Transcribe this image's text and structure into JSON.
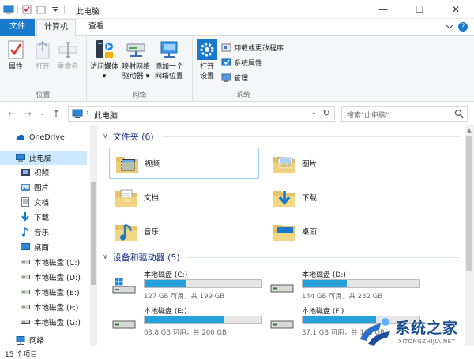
{
  "window": {
    "title": "此电脑",
    "controls": {
      "minimize": "—",
      "maximize": "☐",
      "close": "✕"
    }
  },
  "tabs": {
    "file": "文件",
    "computer": "计算机",
    "view": "查看",
    "help": "?"
  },
  "ribbon": {
    "location": {
      "label": "位置",
      "properties": "属性",
      "open": "打开",
      "rename": "重命名"
    },
    "network": {
      "label": "网络",
      "media": [
        "访问媒体",
        "▾"
      ],
      "map_drive": [
        "映射网络",
        "驱动器 ▾"
      ],
      "add_location": [
        "添加一个",
        "网络位置"
      ]
    },
    "system": {
      "label": "系统",
      "open_settings": [
        "打开",
        "设置"
      ],
      "uninstall": "卸载或更改程序",
      "system_props": "系统属性",
      "manage": "管理"
    }
  },
  "address": {
    "path": "此电脑",
    "search_placeholder": "搜索\"此电脑\"",
    "back": "←",
    "forward": "→",
    "recent": "⌄",
    "up": "↑",
    "refresh": "↻"
  },
  "nav": {
    "items": [
      {
        "label": "OneDrive",
        "icon": "cloud-icon"
      },
      {
        "label": "此电脑",
        "icon": "pc-icon"
      },
      {
        "label": "视频",
        "icon": "video-icon"
      },
      {
        "label": "图片",
        "icon": "picture-icon"
      },
      {
        "label": "文档",
        "icon": "document-icon"
      },
      {
        "label": "下载",
        "icon": "download-icon"
      },
      {
        "label": "音乐",
        "icon": "music-icon"
      },
      {
        "label": "桌面",
        "icon": "desktop-icon"
      },
      {
        "label": "本地磁盘 (C:)",
        "icon": "drive-icon"
      },
      {
        "label": "本地磁盘 (D:)",
        "icon": "drive-icon"
      },
      {
        "label": "本地磁盘 (E:)",
        "icon": "drive-icon"
      },
      {
        "label": "本地磁盘 (F:)",
        "icon": "drive-icon"
      },
      {
        "label": "本地磁盘 (G:)",
        "icon": "drive-icon"
      },
      {
        "label": "网络",
        "icon": "network-icon"
      }
    ]
  },
  "folders_section": {
    "title": "文件夹 (6)"
  },
  "folders": [
    {
      "name": "视频",
      "icon": "video-folder-icon"
    },
    {
      "name": "图片",
      "icon": "picture-folder-icon"
    },
    {
      "name": "文档",
      "icon": "document-folder-icon"
    },
    {
      "name": "下载",
      "icon": "download-folder-icon"
    },
    {
      "name": "音乐",
      "icon": "music-folder-icon"
    },
    {
      "name": "桌面",
      "icon": "desktop-folder-icon"
    }
  ],
  "drives_section": {
    "title": "设备和驱动器 (5)"
  },
  "drives": [
    {
      "name": "本地磁盘 (C:)",
      "info": "127 GB 可用，共 199 GB",
      "used_fraction": 0.36,
      "windows": true
    },
    {
      "name": "本地磁盘 (D:)",
      "info": "144 GB 可用，共 232 GB",
      "used_fraction": 0.38,
      "windows": false
    },
    {
      "name": "本地磁盘 (E:)",
      "info": "63.8 GB 可用，共 200 GB",
      "used_fraction": 0.68,
      "windows": false
    },
    {
      "name": "本地磁盘 (F:)",
      "info": "37.1 GB 可用，共 100 GB",
      "used_fraction": 0.63,
      "windows": false
    }
  ],
  "status": {
    "count": "15 个项目"
  },
  "watermark": {
    "cn": "系统之家",
    "en": "XITONGZHIJIA.NET"
  },
  "colors": {
    "accent": "#1979ca",
    "selection": "#cce8ff",
    "bar_fill": "#26a0da",
    "section_title": "#1e3287"
  }
}
